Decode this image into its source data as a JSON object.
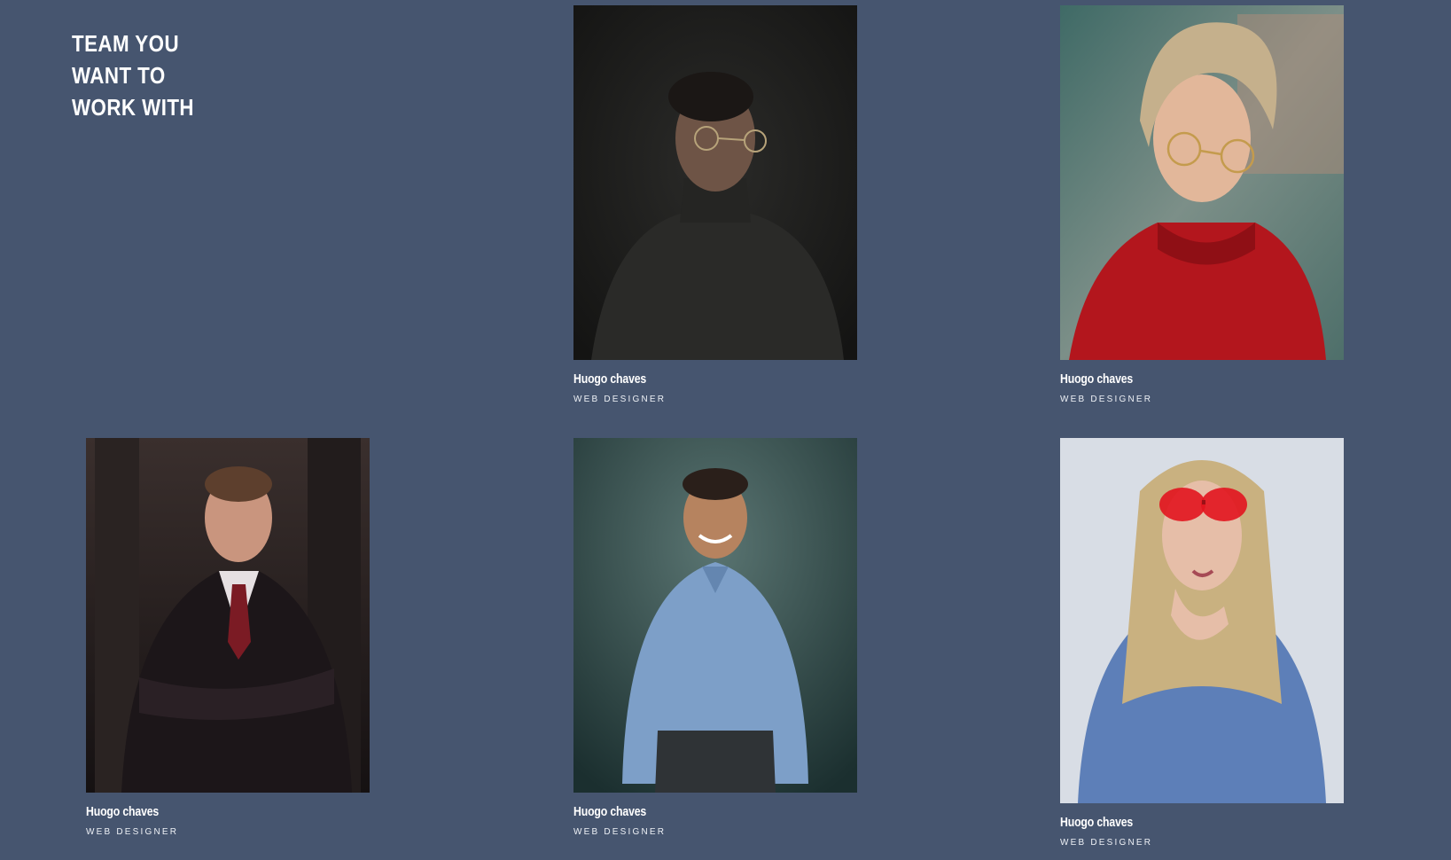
{
  "section": {
    "heading_lines": [
      "TEAM YOU",
      "WANT TO",
      "WORK WITH"
    ]
  },
  "members": [
    {
      "name": "Huogo chaves",
      "role": "WEB DESIGNER",
      "photo_icon": "man-turtleneck-glasses-portrait"
    },
    {
      "name": "Huogo chaves",
      "role": "WEB DESIGNER",
      "photo_icon": "woman-short-hair-red-top-portrait"
    },
    {
      "name": "Huogo chaves",
      "role": "WEB DESIGNER",
      "photo_icon": "man-suit-tie-portrait"
    },
    {
      "name": "Huogo chaves",
      "role": "WEB DESIGNER",
      "photo_icon": "man-blue-shirt-smiling-portrait"
    },
    {
      "name": "Huogo chaves",
      "role": "WEB DESIGNER",
      "photo_icon": "woman-red-sunglasses-denim-portrait"
    }
  ],
  "colors": {
    "background": "#46556f",
    "text": "#ffffff"
  }
}
